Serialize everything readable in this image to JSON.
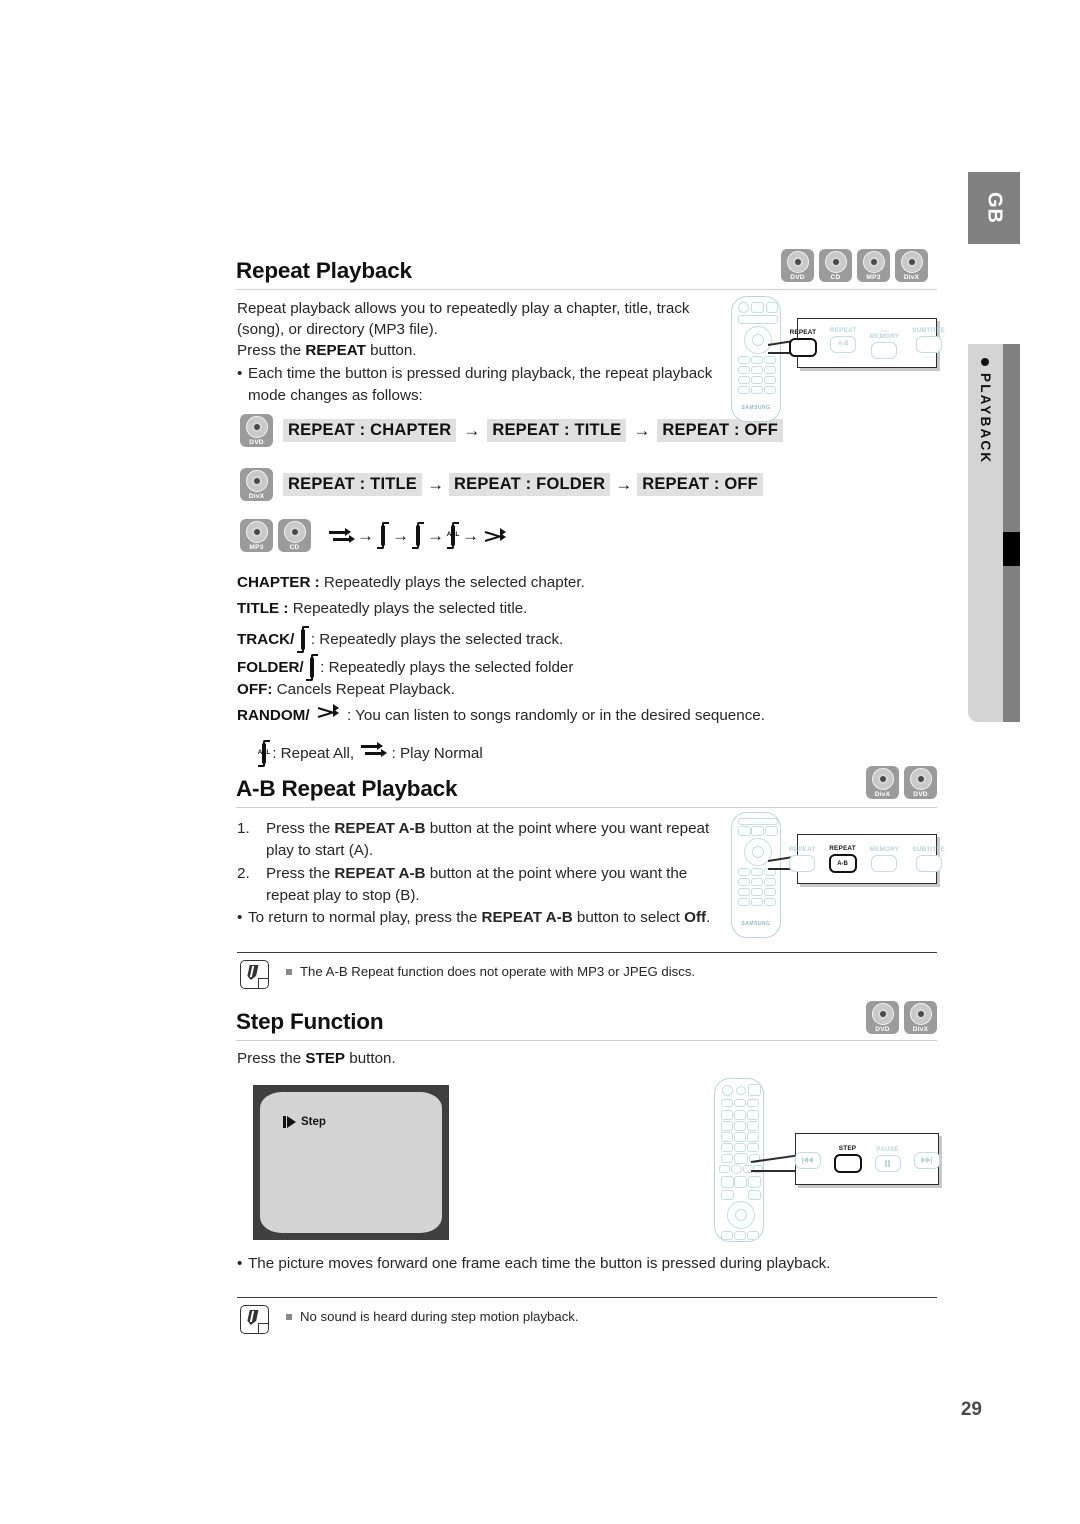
{
  "sidebar": {
    "language_tab": "GB",
    "section_label": "PLAYBACK"
  },
  "page_number": "29",
  "sections": {
    "repeat_playback": {
      "heading": "Repeat Playback",
      "badges": [
        "DVD",
        "CD",
        "MP3",
        "DivX"
      ],
      "intro_line1": "Repeat playback allows you to repeatedly play a chapter, title, track",
      "intro_line2": "(song), or directory (MP3 file).",
      "intro_line3_pre": "Press the ",
      "intro_line3_bold": "REPEAT",
      "intro_line3_post": " button.",
      "bullet1_line1": "Each time the button is pressed during playback, the repeat playback",
      "bullet1_line2": "mode changes as follows:",
      "flow_dvd": {
        "badge": "DVD",
        "steps": [
          "REPEAT : CHAPTER",
          "REPEAT : TITLE",
          "REPEAT : OFF"
        ]
      },
      "flow_divx": {
        "badge": "DivX",
        "steps": [
          "REPEAT : TITLE",
          "REPEAT : FOLDER",
          "REPEAT :  OFF"
        ]
      },
      "flow_mp3cd": {
        "badges": [
          "MP3",
          "CD"
        ],
        "icon_steps": [
          "play-normal-icon",
          "repeat-track-icon",
          "repeat-folder-icon",
          "repeat-all-icon",
          "random-icon"
        ],
        "repeat_all_text": "ALL"
      },
      "definitions": [
        {
          "term": "CHAPTER :",
          "icon": "",
          "desc": " Repeatedly plays the selected chapter."
        },
        {
          "term": "TITLE :",
          "icon": "",
          "desc": " Repeatedly plays the selected title."
        },
        {
          "term": "TRACK/",
          "icon": "repeat-track-icon",
          "desc": " : Repeatedly plays the selected track."
        },
        {
          "term": "FOLDER/",
          "icon": "repeat-folder-icon",
          "desc": " : Repeatedly plays the selected folder"
        },
        {
          "term": "OFF:",
          "icon": "",
          "desc": " Cancels Repeat Playback."
        },
        {
          "term": "RANDOM/",
          "icon": "random-icon",
          "desc": " : You can listen to songs randomly or in the desired sequence."
        }
      ],
      "legend": {
        "all_icon": "repeat-all-icon",
        "all_text": " : Repeat All, ",
        "normal_icon": "play-normal-icon",
        "normal_text": " : Play Normal"
      },
      "callout": {
        "buttons": [
          {
            "label": "REPEAT",
            "sublabel": "",
            "key_text": "",
            "active": true
          },
          {
            "label": "REPEAT",
            "sublabel": "",
            "key_text": "A-B",
            "active": false
          },
          {
            "label": "MEMORY",
            "sublabel": "",
            "key_text": "",
            "active": false
          },
          {
            "label": "SUBTITLE",
            "sublabel": "",
            "key_text": "",
            "active": false
          }
        ]
      }
    },
    "ab_repeat": {
      "heading": "A-B Repeat Playback",
      "badges": [
        "DivX",
        "DVD"
      ],
      "steps": [
        {
          "num": "1.",
          "pre": "Press the ",
          "bold": "REPEAT A-B",
          "post": " button at the point where you want repeat",
          "line2": "play to start (A)."
        },
        {
          "num": "2.",
          "pre": "Press the ",
          "bold": "REPEAT A-B",
          "post": " button at the point where you want the",
          "line2": "repeat play to stop (B)."
        }
      ],
      "bullet_pre": "To return to normal play, press the ",
      "bullet_bold": "REPEAT A-B",
      "bullet_mid": " button to select ",
      "bullet_bold2": "Off",
      "bullet_post": ".",
      "note": "The A-B Repeat function does not operate with MP3 or JPEG discs.",
      "callout": {
        "buttons": [
          {
            "label": "REPEAT",
            "sublabel": "",
            "key_text": "",
            "active": false
          },
          {
            "label": "REPEAT",
            "sublabel": "",
            "key_text": "A-B",
            "active": true
          },
          {
            "label": "MEMORY",
            "sublabel": "",
            "key_text": "",
            "active": false
          },
          {
            "label": "SUBTITLE",
            "sublabel": "",
            "key_text": "",
            "active": false
          }
        ]
      }
    },
    "step_function": {
      "heading": "Step Function",
      "badges": [
        "DVD",
        "DivX"
      ],
      "intro_pre": "Press the ",
      "intro_bold": "STEP",
      "intro_post": " button.",
      "tv_osd_label": "Step",
      "bullet": "The picture moves forward one frame each time the button is pressed during playback.",
      "note": "No sound is heard during step motion playback.",
      "callout": {
        "buttons": [
          {
            "label": "",
            "sublabel": "",
            "key_icon": "prev-track-icon",
            "active": false
          },
          {
            "label": "STEP",
            "sublabel": "",
            "key_icon": "",
            "active": true
          },
          {
            "label": "PAUSE",
            "sublabel": "",
            "key_icon": "pause-icon",
            "active": false
          },
          {
            "label": "",
            "sublabel": "",
            "key_icon": "next-track-icon",
            "active": false
          }
        ]
      }
    }
  }
}
